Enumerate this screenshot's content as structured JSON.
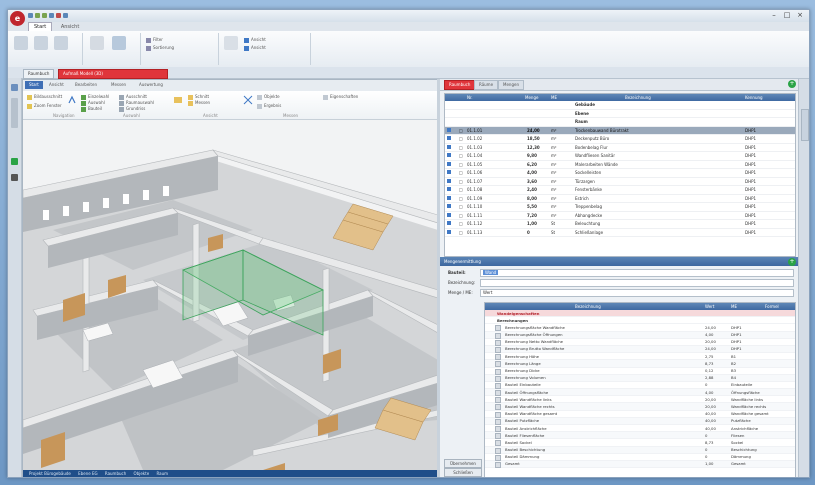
{
  "window": {
    "logo": "e",
    "title": "",
    "controls": [
      "–",
      "□",
      "×"
    ]
  },
  "ribbon": {
    "tabs": [
      {
        "label": "Start",
        "active": true
      },
      {
        "label": "Ansicht",
        "active": false
      }
    ]
  },
  "document_tabs": [
    {
      "label": "Raumbuch",
      "red": false
    },
    {
      "label": "Aufmaß Modell (3D)",
      "red": true
    }
  ],
  "viewer": {
    "tabs": [
      {
        "label": "Start",
        "active": true
      },
      {
        "label": "Ansicht",
        "active": false
      },
      {
        "label": "Bearbeiten",
        "active": false
      },
      {
        "label": "Messen",
        "active": false
      },
      {
        "label": "Auswertung",
        "active": false
      }
    ],
    "ribbon_items": [
      "Bildausschnitt",
      "Zoom Fenster",
      "Ansicht drehen",
      "Einzelwahl",
      "Auswahl",
      "Bauteil",
      "Ausschnitt",
      "Raumauswahl",
      "Grundriss",
      "Schnitt",
      "Messen",
      "Flächen",
      "Objekte",
      "Ergebnis",
      "Eigenschaften"
    ],
    "group_labels": [
      "Navigation",
      "Auswahl",
      "Ansicht",
      "Messen"
    ],
    "status": [
      "Projekt Bürogebäude",
      "Ebene EG",
      "Raumbuch",
      "Objekte",
      "Raum"
    ]
  },
  "right_panel": {
    "tabs": [
      {
        "label": "Raumbuch",
        "active": true
      },
      {
        "label": "Räume",
        "active": false
      },
      {
        "label": "Mengen",
        "active": false
      }
    ],
    "grid_columns": [
      "",
      "Nr.",
      "Menge",
      "ME",
      "Bezeichnung",
      "Kennung"
    ],
    "group_rows": [
      "Gebäude",
      "Ebene",
      "Raum"
    ],
    "rows": [
      {
        "nr": "01.1.01",
        "menge": "24,00",
        "me": "m²",
        "text": "Trockenbauwand Bürotrakt",
        "code": "DHP1",
        "selected": true
      },
      {
        "nr": "01.1.02",
        "menge": "18,50",
        "me": "m²",
        "text": "Deckenputz Büro",
        "code": "DHP1"
      },
      {
        "nr": "01.1.03",
        "menge": "12,30",
        "me": "m²",
        "text": "Bodenbelag Flur",
        "code": "DHP1"
      },
      {
        "nr": "01.1.04",
        "menge": "9,80",
        "me": "m²",
        "text": "Wandfliesen Sanitär",
        "code": "DHP1"
      },
      {
        "nr": "01.1.05",
        "menge": "6,20",
        "me": "m²",
        "text": "Malerarbeiten Wände",
        "code": "DHP1"
      },
      {
        "nr": "01.1.06",
        "menge": "4,00",
        "me": "m²",
        "text": "Sockelleisten",
        "code": "DHP1"
      },
      {
        "nr": "01.1.07",
        "menge": "3,60",
        "me": "m²",
        "text": "Türzargen",
        "code": "DHP1"
      },
      {
        "nr": "01.1.08",
        "menge": "2,40",
        "me": "m²",
        "text": "Fensterbänke",
        "code": "DHP1"
      },
      {
        "nr": "01.1.09",
        "menge": "8,00",
        "me": "m²",
        "text": "Estrich",
        "code": "DHP1"
      },
      {
        "nr": "01.1.10",
        "menge": "5,50",
        "me": "m²",
        "text": "Treppenbelag",
        "code": "DHP1"
      },
      {
        "nr": "01.1.11",
        "menge": "7,20",
        "me": "m²",
        "text": "Abhangdecke",
        "code": "DHP1"
      },
      {
        "nr": "01.1.12",
        "menge": "1,00",
        "me": "St",
        "text": "Beleuchtung",
        "code": "DHP1"
      },
      {
        "nr": "01.1.13",
        "menge": "0",
        "me": "St",
        "text": "Schließanlage",
        "code": "DHP1"
      }
    ],
    "detail_header": "Mengenermittlung",
    "form": {
      "label1": "Bauteil:",
      "value1": "Wand",
      "label2": "Bezeichnung:",
      "label3": "Menge / ME:",
      "value3": "Wert"
    },
    "detail_columns": [
      "",
      "Bezeichnung",
      "Wert",
      "ME",
      "Formel"
    ],
    "detail_group1": "Wandeigenschaften",
    "detail_group2": "Berechnungen",
    "detail_rows": [
      {
        "label": "Berechnungsfläche Wandfläche",
        "value": "24,00",
        "unit": "DHP1"
      },
      {
        "label": "Berechnungsfläche Öffnungen",
        "value": "4,00",
        "unit": "DHP1"
      },
      {
        "label": "Berechnung Netto Wandfläche",
        "value": "20,00",
        "unit": "DHP1"
      },
      {
        "label": "Berechnung Brutto Wandfläche",
        "value": "24,00",
        "unit": "DHP1"
      },
      {
        "label": "Berechnung Höhe",
        "value": "2,75",
        "unit": "B1"
      },
      {
        "label": "Berechnung Länge",
        "value": "8,73",
        "unit": "B2"
      },
      {
        "label": "Berechnung Dicke",
        "value": "0,12",
        "unit": "B3"
      },
      {
        "label": "Berechnung Volumen",
        "value": "2,88",
        "unit": "B4"
      },
      {
        "label": "Bauteil Einbauteile",
        "value": "0",
        "unit": "Einbauteile"
      },
      {
        "label": "Bauteil Öffnungsfläche",
        "value": "4,00",
        "unit": "Öffnungsfläche"
      },
      {
        "label": "Bauteil Wandfläche links",
        "value": "20,00",
        "unit": "Wandfläche links"
      },
      {
        "label": "Bauteil Wandfläche rechts",
        "value": "20,00",
        "unit": "Wandfläche rechts"
      },
      {
        "label": "Bauteil Wandfläche gesamt",
        "value": "40,00",
        "unit": "Wandfläche gesamt"
      },
      {
        "label": "Bauteil Putzfläche",
        "value": "40,00",
        "unit": "Putzfläche"
      },
      {
        "label": "Bauteil Anstrichfläche",
        "value": "40,00",
        "unit": "Anstrichfläche"
      },
      {
        "label": "Bauteil Fliesenfläche",
        "value": "0",
        "unit": "Fliesen"
      },
      {
        "label": "Bauteil Sockel",
        "value": "8,73",
        "unit": "Sockel"
      },
      {
        "label": "Bauteil Beschichtung",
        "value": "0",
        "unit": "Beschichtung"
      },
      {
        "label": "Bauteil Dämmung",
        "value": "0",
        "unit": "Dämmung"
      },
      {
        "label": "Gesamt",
        "value": "1,00",
        "unit": "Gesamt"
      }
    ],
    "side_buttons": [
      "Übernehmen",
      "Schließen"
    ]
  }
}
